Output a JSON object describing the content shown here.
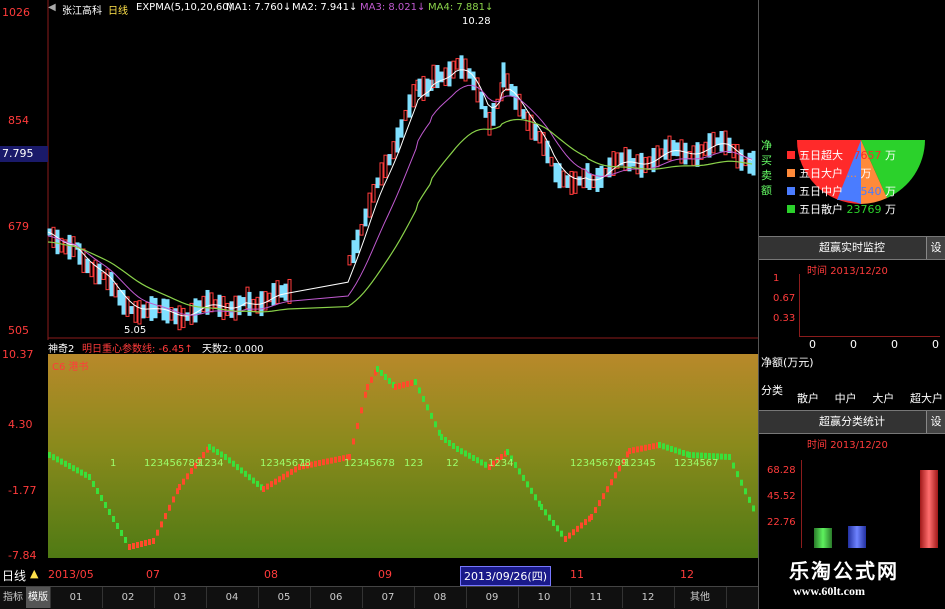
{
  "stock": {
    "name": "张江高科",
    "period": "日线",
    "indicator": "EXPMA(5,10,20,60)",
    "ma1": "MA1: 7.760↓",
    "ma2": "MA2: 7.941↓",
    "ma3": "MA3: 8.021↓",
    "ma4": "MA4: 7.881↓",
    "current_price": "7.795",
    "high_label": "10.28",
    "low_label": "5.05"
  },
  "main_axis": {
    "labels": [
      "1026",
      "854",
      "679",
      "505"
    ]
  },
  "oscillator": {
    "name": "神奇2",
    "param1": "明日重心参数线: -6.45↑",
    "param2": "天数2: 0.000",
    "sub_label": "C6 港书",
    "axis": [
      "10.37",
      "4.30",
      "-1.77",
      "-7.84"
    ],
    "seq_labels": [
      "1",
      "123456789",
      "1234",
      "12345678",
      "1",
      "12345678",
      "123",
      "12",
      "1234",
      "123456789",
      "12345",
      "1234567"
    ]
  },
  "date_axis": {
    "period_label": "日线",
    "labels": [
      "2013/05",
      "07",
      "08",
      "09",
      "11",
      "12"
    ],
    "highlight": "2013/09/26(四)"
  },
  "tabs": [
    "指标",
    "模版",
    "01",
    "02",
    "03",
    "04",
    "05",
    "06",
    "07",
    "08",
    "09",
    "10",
    "11",
    "12",
    "其他"
  ],
  "side": {
    "side_labels": [
      "净",
      "买",
      "卖",
      "额"
    ],
    "legend": [
      {
        "label": "五日超大",
        "value": "17657",
        "unit": "万",
        "color": "#ff2a2a"
      },
      {
        "label": "五日大户",
        "value": "...",
        "unit": "万",
        "color": "#ff8a3a"
      },
      {
        "label": "五日中户",
        "value": "16540",
        "unit": "万",
        "color": "#4a7cff"
      },
      {
        "label": "五日散户",
        "value": "23769",
        "unit": "万",
        "color": "#2bd12b"
      }
    ],
    "panel1": {
      "title": "超赢实时监控",
      "set": "设",
      "time_label": "时间",
      "time_value": "2013/12/20",
      "axis": [
        "1",
        "0.67",
        "0.33"
      ],
      "values": [
        "0",
        "0",
        "0",
        "0"
      ],
      "net_label": "净额(万元)",
      "cls_label": "分类",
      "classes": [
        "散户",
        "中户",
        "大户",
        "超大户"
      ]
    },
    "panel2": {
      "title": "超赢分类统计",
      "set": "设",
      "time_label": "时间",
      "time_value": "2013/12/20",
      "axis": [
        "68.28",
        "45.52",
        "22.76"
      ]
    }
  },
  "watermark": {
    "title": "乐淘公式网",
    "url": "www.60lt.com"
  },
  "colors": {
    "up": "#ff3b3b",
    "down": "#7fe0ff",
    "ma_white": "#ffffff",
    "ma_purple": "#c05ad0",
    "ma_green": "#8ad24a"
  }
}
